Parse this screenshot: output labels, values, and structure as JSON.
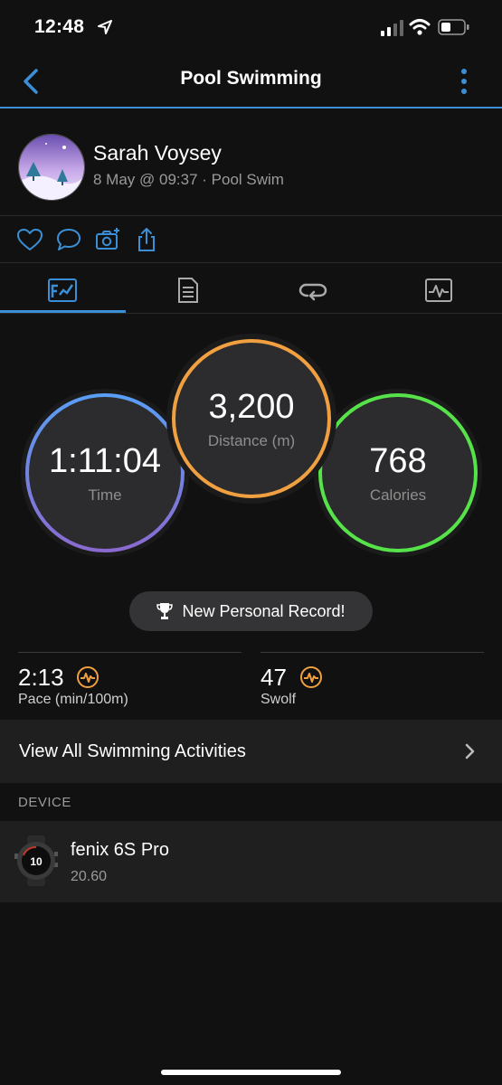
{
  "status_bar": {
    "time": "12:48"
  },
  "header": {
    "title": "Pool Swimming"
  },
  "profile": {
    "name": "Sarah Voysey",
    "meta": "8 May @ 09:37 · Pool Swim"
  },
  "actions": [
    "heart-icon",
    "comment-icon",
    "camera-add-icon",
    "share-icon"
  ],
  "tabs": [
    {
      "icon": "summary-chart-icon",
      "selected": true
    },
    {
      "icon": "details-list-icon",
      "selected": false
    },
    {
      "icon": "laps-icon",
      "selected": false
    },
    {
      "icon": "graph-icon",
      "selected": false
    }
  ],
  "metrics": {
    "time": {
      "value": "1:11:04",
      "label": "Time"
    },
    "distance": {
      "value": "3,200",
      "label": "Distance (m)"
    },
    "calories": {
      "value": "768",
      "label": "Calories"
    }
  },
  "personal_record": {
    "label": "New Personal Record!"
  },
  "stats": {
    "pace": {
      "value": "2:13",
      "label": "Pace (min/100m)"
    },
    "swolf": {
      "value": "47",
      "label": "Swolf"
    }
  },
  "view_all": {
    "label": "View All Swimming Activities"
  },
  "device_section": {
    "label": "DEVICE"
  },
  "device": {
    "name": "fenix 6S Pro",
    "version": "20.60",
    "watch_face_value": "10"
  },
  "colors": {
    "accent": "#3a8fd6",
    "time_ring": "#5f9df7",
    "distance_ring": "#f0a040",
    "calories_ring": "#56e34a",
    "badge": "#f0a040"
  }
}
